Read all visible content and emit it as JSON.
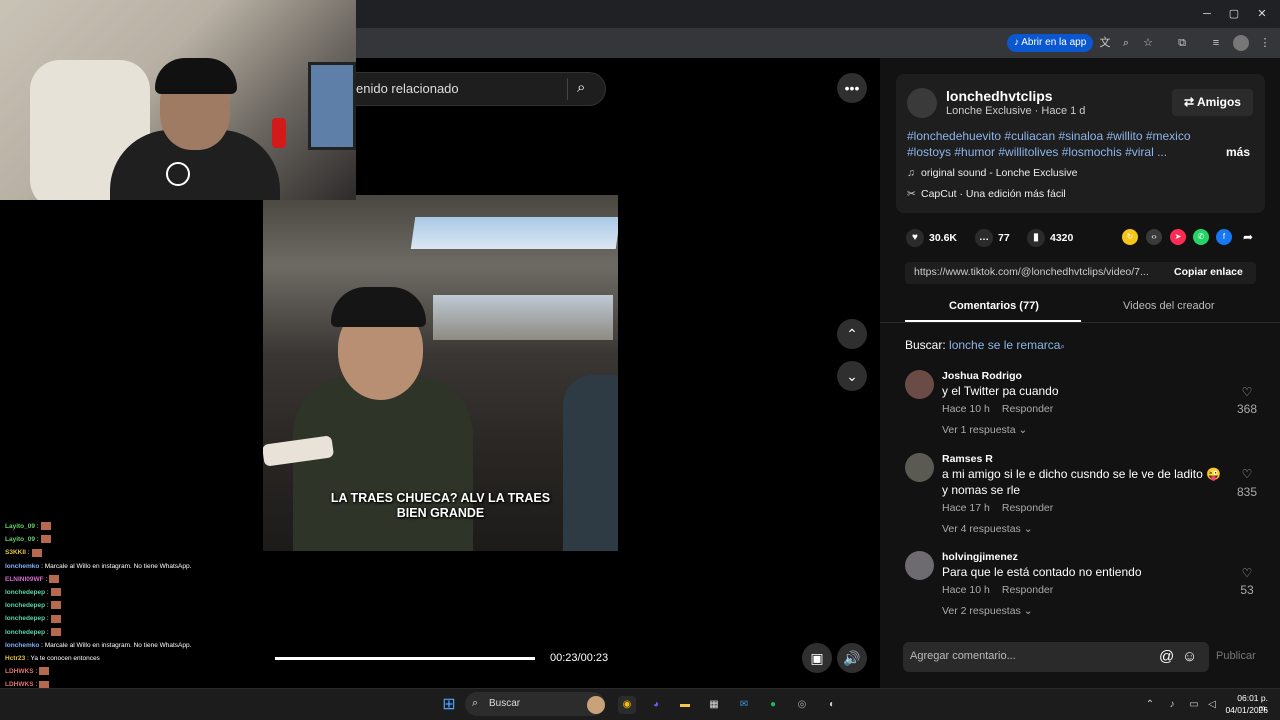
{
  "browser": {
    "open_in_app": "Abrir en la app",
    "minimize": "─",
    "maximize": "▢",
    "close": "✕"
  },
  "player": {
    "search_text": "enido relacionado",
    "caption_line1": "LA TRAES CHUECA? ALV LA TRAES",
    "caption_line2": "BIEN GRANDE",
    "time": "00:23/00:23",
    "progress_fraction": 1.0
  },
  "chat": [
    {
      "user": "Layito_09",
      "color": "#6ad16a",
      "msg": ":"
    },
    {
      "user": "Layito_09",
      "color": "#6ad16a",
      "msg": ":"
    },
    {
      "user": "S3KKII",
      "color": "#e6c24a",
      "msg": ":"
    },
    {
      "user": "lonchemko",
      "color": "#7fb3ff",
      "msg": ": Marcale al Willo en instagram. No tiene WhatsApp."
    },
    {
      "user": "ELNINI09WF",
      "color": "#d46acf",
      "msg": ":"
    },
    {
      "user": "lonchedepep",
      "color": "#59d6a8",
      "msg": ":"
    },
    {
      "user": "lonchedepep",
      "color": "#59d6a8",
      "msg": ":"
    },
    {
      "user": "lonchedepep",
      "color": "#59d6a8",
      "msg": ":"
    },
    {
      "user": "lonchedepep",
      "color": "#59d6a8",
      "msg": ":"
    },
    {
      "user": "lonchemko",
      "color": "#7fb3ff",
      "msg": ": Marcale al Willo en instagram. No tiene WhatsApp."
    },
    {
      "user": "Hctr23",
      "color": "#e6c24a",
      "msg": ": Ya te conocen entonces"
    },
    {
      "user": "LDHWKS",
      "color": "#e07070",
      "msg": ":"
    },
    {
      "user": "LDHWKS",
      "color": "#e07070",
      "msg": ":"
    }
  ],
  "panel": {
    "author": "lonchedhvtclips",
    "author_sub": "Lonche Exclusive · Hace 1 d",
    "friends_btn": "Amigos",
    "hashtags_line1": "#lonchedehuevito #culiacan #sinaloa #willito #mexico",
    "hashtags_line2": "#lostoys #humor #willitolives #losmochis #viral ...",
    "more": "más",
    "sound": "original sound - Lonche Exclusive",
    "capcut": "CapCut · Una edición más fácil",
    "likes": "30.6K",
    "comments_count": "77",
    "saves": "4320",
    "url": "https://www.tiktok.com/@lonchedhvtclips/video/7...",
    "copy_link": "Copiar enlace",
    "tab_comments": "Comentarios (77)",
    "tab_creator": "Videos del creador",
    "search_label": "Buscar:",
    "search_keyword": "lonche se le remarca",
    "comment_placeholder": "Agregar comentario...",
    "publish": "Publicar"
  },
  "comments": [
    {
      "name": "Joshua Rodrigo",
      "text": "y el Twitter pa cuando",
      "time": "Hace 10 h",
      "reply": "Responder",
      "replies": "Ver 1 respuesta",
      "likes": "368"
    },
    {
      "name": "Ramses R",
      "text": "a mi amigo si le e dicho cusndo se le ve de ladito 😜 y nomas se rle",
      "time": "Hace 17 h",
      "reply": "Responder",
      "replies": "Ver 4 respuestas",
      "likes": "835"
    },
    {
      "name": "holvingjimenez",
      "text": "Para que le está contado no entiendo",
      "time": "Hace 10 h",
      "reply": "Responder",
      "replies": "Ver 2 respuestas",
      "likes": "53"
    }
  ],
  "taskbar": {
    "search": "Buscar",
    "time": "06:01 p. m.",
    "date": "04/01/2026"
  },
  "colors": {
    "accent_link": "#8fb4e8",
    "tiktok_blue": "#0b57d0"
  }
}
